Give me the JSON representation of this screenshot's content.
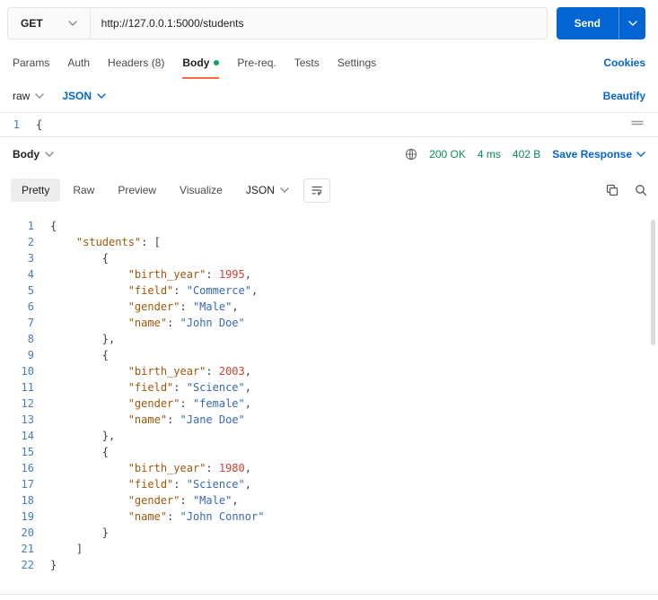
{
  "colors": {
    "accent_blue": "#0265D2",
    "brand_orange": "#FF6C37",
    "success_green": "#0E8A57",
    "json_key": "#A35709",
    "json_string": "#3867B5",
    "json_number": "#CE4134"
  },
  "request_bar": {
    "method": "GET",
    "url": "http://127.0.0.1:5000/students",
    "send_label": "Send"
  },
  "request_tabs": {
    "items": [
      {
        "label": "Params"
      },
      {
        "label": "Auth"
      },
      {
        "label": "Headers (8)"
      },
      {
        "label": "Body"
      },
      {
        "label": "Pre-req."
      },
      {
        "label": "Tests"
      },
      {
        "label": "Settings"
      }
    ],
    "cookies_link": "Cookies"
  },
  "body_toolbar": {
    "mode": "raw",
    "language": "JSON",
    "beautify_link": "Beautify"
  },
  "request_editor": {
    "lines": [
      {
        "n": 1,
        "t": [
          [
            "p",
            "{"
          ]
        ]
      }
    ]
  },
  "response_header": {
    "body_label": "Body",
    "status": "200 OK",
    "time": "4 ms",
    "size": "402 B",
    "save_label": "Save Response"
  },
  "response_toolbar": {
    "tabs": [
      {
        "label": "Pretty"
      },
      {
        "label": "Raw"
      },
      {
        "label": "Preview"
      },
      {
        "label": "Visualize"
      }
    ],
    "language": "JSON"
  },
  "response_editor": {
    "lines": [
      {
        "n": 1,
        "t": [
          [
            "p",
            "{"
          ]
        ]
      },
      {
        "n": 2,
        "t": [
          [
            "w",
            "    "
          ],
          [
            "k",
            "\"students\""
          ],
          [
            "p",
            ": ["
          ]
        ]
      },
      {
        "n": 3,
        "t": [
          [
            "w",
            "        "
          ],
          [
            "p",
            "{"
          ]
        ]
      },
      {
        "n": 4,
        "t": [
          [
            "w",
            "            "
          ],
          [
            "k",
            "\"birth_year\""
          ],
          [
            "p",
            ": "
          ],
          [
            "n",
            "1995"
          ],
          [
            "p",
            ","
          ]
        ]
      },
      {
        "n": 5,
        "t": [
          [
            "w",
            "            "
          ],
          [
            "k",
            "\"field\""
          ],
          [
            "p",
            ": "
          ],
          [
            "s",
            "\"Commerce\""
          ],
          [
            "p",
            ","
          ]
        ]
      },
      {
        "n": 6,
        "t": [
          [
            "w",
            "            "
          ],
          [
            "k",
            "\"gender\""
          ],
          [
            "p",
            ": "
          ],
          [
            "s",
            "\"Male\""
          ],
          [
            "p",
            ","
          ]
        ]
      },
      {
        "n": 7,
        "t": [
          [
            "w",
            "            "
          ],
          [
            "k",
            "\"name\""
          ],
          [
            "p",
            ": "
          ],
          [
            "s",
            "\"John Doe\""
          ]
        ]
      },
      {
        "n": 8,
        "t": [
          [
            "w",
            "        "
          ],
          [
            "p",
            "},"
          ]
        ]
      },
      {
        "n": 9,
        "t": [
          [
            "w",
            "        "
          ],
          [
            "p",
            "{"
          ]
        ]
      },
      {
        "n": 10,
        "t": [
          [
            "w",
            "            "
          ],
          [
            "k",
            "\"birth_year\""
          ],
          [
            "p",
            ": "
          ],
          [
            "n",
            "2003"
          ],
          [
            "p",
            ","
          ]
        ]
      },
      {
        "n": 11,
        "t": [
          [
            "w",
            "            "
          ],
          [
            "k",
            "\"field\""
          ],
          [
            "p",
            ": "
          ],
          [
            "s",
            "\"Science\""
          ],
          [
            "p",
            ","
          ]
        ]
      },
      {
        "n": 12,
        "t": [
          [
            "w",
            "            "
          ],
          [
            "k",
            "\"gender\""
          ],
          [
            "p",
            ": "
          ],
          [
            "s",
            "\"female\""
          ],
          [
            "p",
            ","
          ]
        ]
      },
      {
        "n": 13,
        "t": [
          [
            "w",
            "            "
          ],
          [
            "k",
            "\"name\""
          ],
          [
            "p",
            ": "
          ],
          [
            "s",
            "\"Jane Doe\""
          ]
        ]
      },
      {
        "n": 14,
        "t": [
          [
            "w",
            "        "
          ],
          [
            "p",
            "},"
          ]
        ]
      },
      {
        "n": 15,
        "t": [
          [
            "w",
            "        "
          ],
          [
            "p",
            "{"
          ]
        ]
      },
      {
        "n": 16,
        "t": [
          [
            "w",
            "            "
          ],
          [
            "k",
            "\"birth_year\""
          ],
          [
            "p",
            ": "
          ],
          [
            "n",
            "1980"
          ],
          [
            "p",
            ","
          ]
        ]
      },
      {
        "n": 17,
        "t": [
          [
            "w",
            "            "
          ],
          [
            "k",
            "\"field\""
          ],
          [
            "p",
            ": "
          ],
          [
            "s",
            "\"Science\""
          ],
          [
            "p",
            ","
          ]
        ]
      },
      {
        "n": 18,
        "t": [
          [
            "w",
            "            "
          ],
          [
            "k",
            "\"gender\""
          ],
          [
            "p",
            ": "
          ],
          [
            "s",
            "\"Male\""
          ],
          [
            "p",
            ","
          ]
        ]
      },
      {
        "n": 19,
        "t": [
          [
            "w",
            "            "
          ],
          [
            "k",
            "\"name\""
          ],
          [
            "p",
            ": "
          ],
          [
            "s",
            "\"John Connor\""
          ]
        ]
      },
      {
        "n": 20,
        "t": [
          [
            "w",
            "        "
          ],
          [
            "p",
            "}"
          ]
        ]
      },
      {
        "n": 21,
        "t": [
          [
            "w",
            "    "
          ],
          [
            "p",
            "]"
          ]
        ]
      },
      {
        "n": 22,
        "t": [
          [
            "p",
            "}"
          ]
        ]
      }
    ]
  },
  "icons": [
    "chevron-down-icon",
    "globe-icon",
    "wrap-text-icon",
    "copy-icon",
    "search-icon",
    "collapse-editor-icon",
    "unsaved-changes-dot"
  ]
}
